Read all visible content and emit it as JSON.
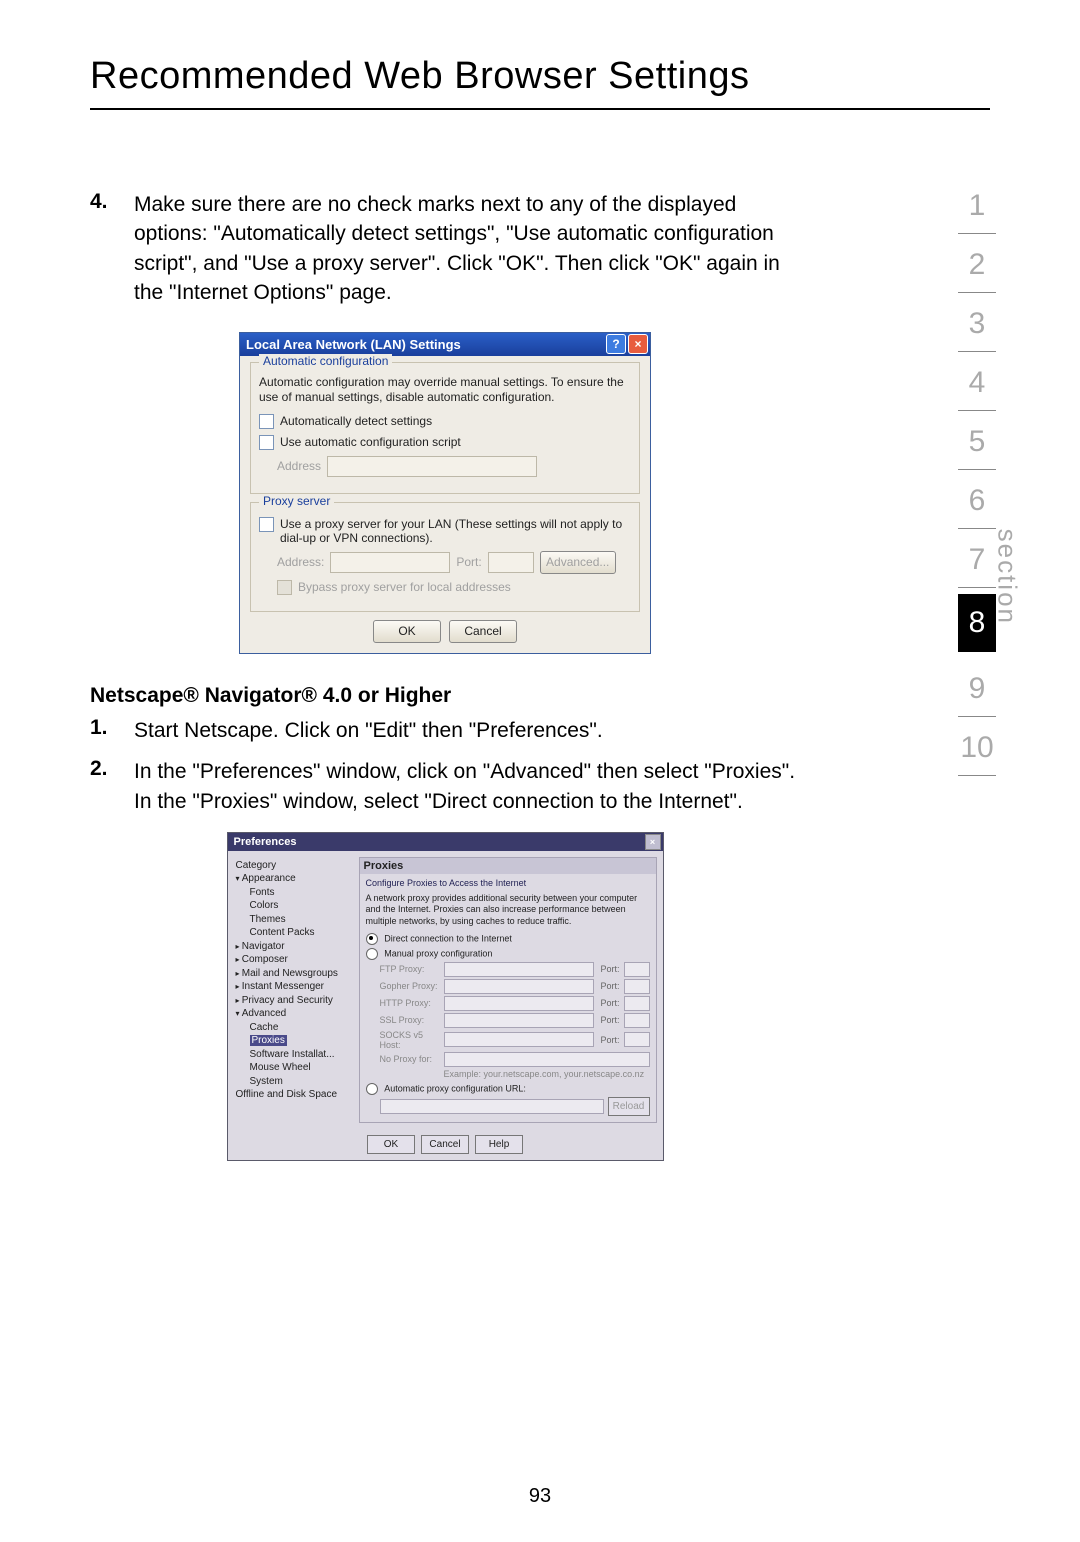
{
  "page": {
    "title": "Recommended Web Browser Settings",
    "number": "93"
  },
  "side_nav": {
    "label": "section",
    "items": [
      "1",
      "2",
      "3",
      "4",
      "5",
      "6",
      "7",
      "8",
      "9",
      "10"
    ],
    "active": "8"
  },
  "step4": {
    "num": "4.",
    "text": "Make sure there are no check marks next to any of the displayed options: \"Automatically detect settings\", \"Use automatic configuration script\", and \"Use a proxy server\". Click \"OK\". Then click \"OK\" again in the \"Internet Options\" page."
  },
  "lan": {
    "title": "Local Area Network (LAN) Settings",
    "group1": {
      "legend": "Automatic configuration",
      "desc": "Automatic configuration may override manual settings. To ensure the use of manual settings, disable automatic configuration.",
      "chk1": "Automatically detect settings",
      "chk2": "Use automatic configuration script",
      "addr_ph": "Address"
    },
    "group2": {
      "legend": "Proxy server",
      "chk": "Use a proxy server for your LAN (These settings will not apply to dial-up or VPN connections).",
      "addr": "Address:",
      "port": "Port:",
      "adv": "Advanced...",
      "bypass": "Bypass proxy server for local addresses"
    },
    "ok": "OK",
    "cancel": "Cancel"
  },
  "netscape": {
    "heading": "Netscape® Navigator® 4.0 or Higher",
    "step1": {
      "num": "1.",
      "text": "Start Netscape. Click on \"Edit\" then \"Preferences\"."
    },
    "step2": {
      "num": "2.",
      "text": "In the \"Preferences\" window, click on \"Advanced\" then select \"Proxies\". In the \"Proxies\" window, select \"Direct connection to the Internet\"."
    }
  },
  "pref": {
    "title": "Preferences",
    "cat_label": "Category",
    "tree": {
      "appearance": "Appearance",
      "fonts": "Fonts",
      "colors": "Colors",
      "themes": "Themes",
      "content_packs": "Content Packs",
      "navigator": "Navigator",
      "composer": "Composer",
      "mail": "Mail and Newsgroups",
      "im": "Instant Messenger",
      "privacy": "Privacy and Security",
      "advanced": "Advanced",
      "cache": "Cache",
      "proxies": "Proxies",
      "software": "Software Installat...",
      "mouse": "Mouse Wheel",
      "system": "System",
      "offline": "Offline and Disk Space"
    },
    "panel": {
      "title": "Proxies",
      "sub": "Configure Proxies to Access the Internet",
      "desc": "A network proxy provides additional security between your computer and the Internet. Proxies can also increase performance between multiple networks, by using caches to reduce traffic.",
      "r1": "Direct connection to the Internet",
      "r2": "Manual proxy configuration",
      "rows": {
        "ftp": "FTP Proxy:",
        "gopher": "Gopher Proxy:",
        "http": "HTTP Proxy:",
        "ssl": "SSL Proxy:",
        "socks": "SOCKS v5 Host:",
        "noproxy": "No Proxy for:",
        "port": "Port:"
      },
      "example": "Example: your.netscape.com, your.netscape.co.nz",
      "r3": "Automatic proxy configuration URL:",
      "reload": "Reload"
    },
    "ok": "OK",
    "cancel": "Cancel",
    "help": "Help"
  }
}
